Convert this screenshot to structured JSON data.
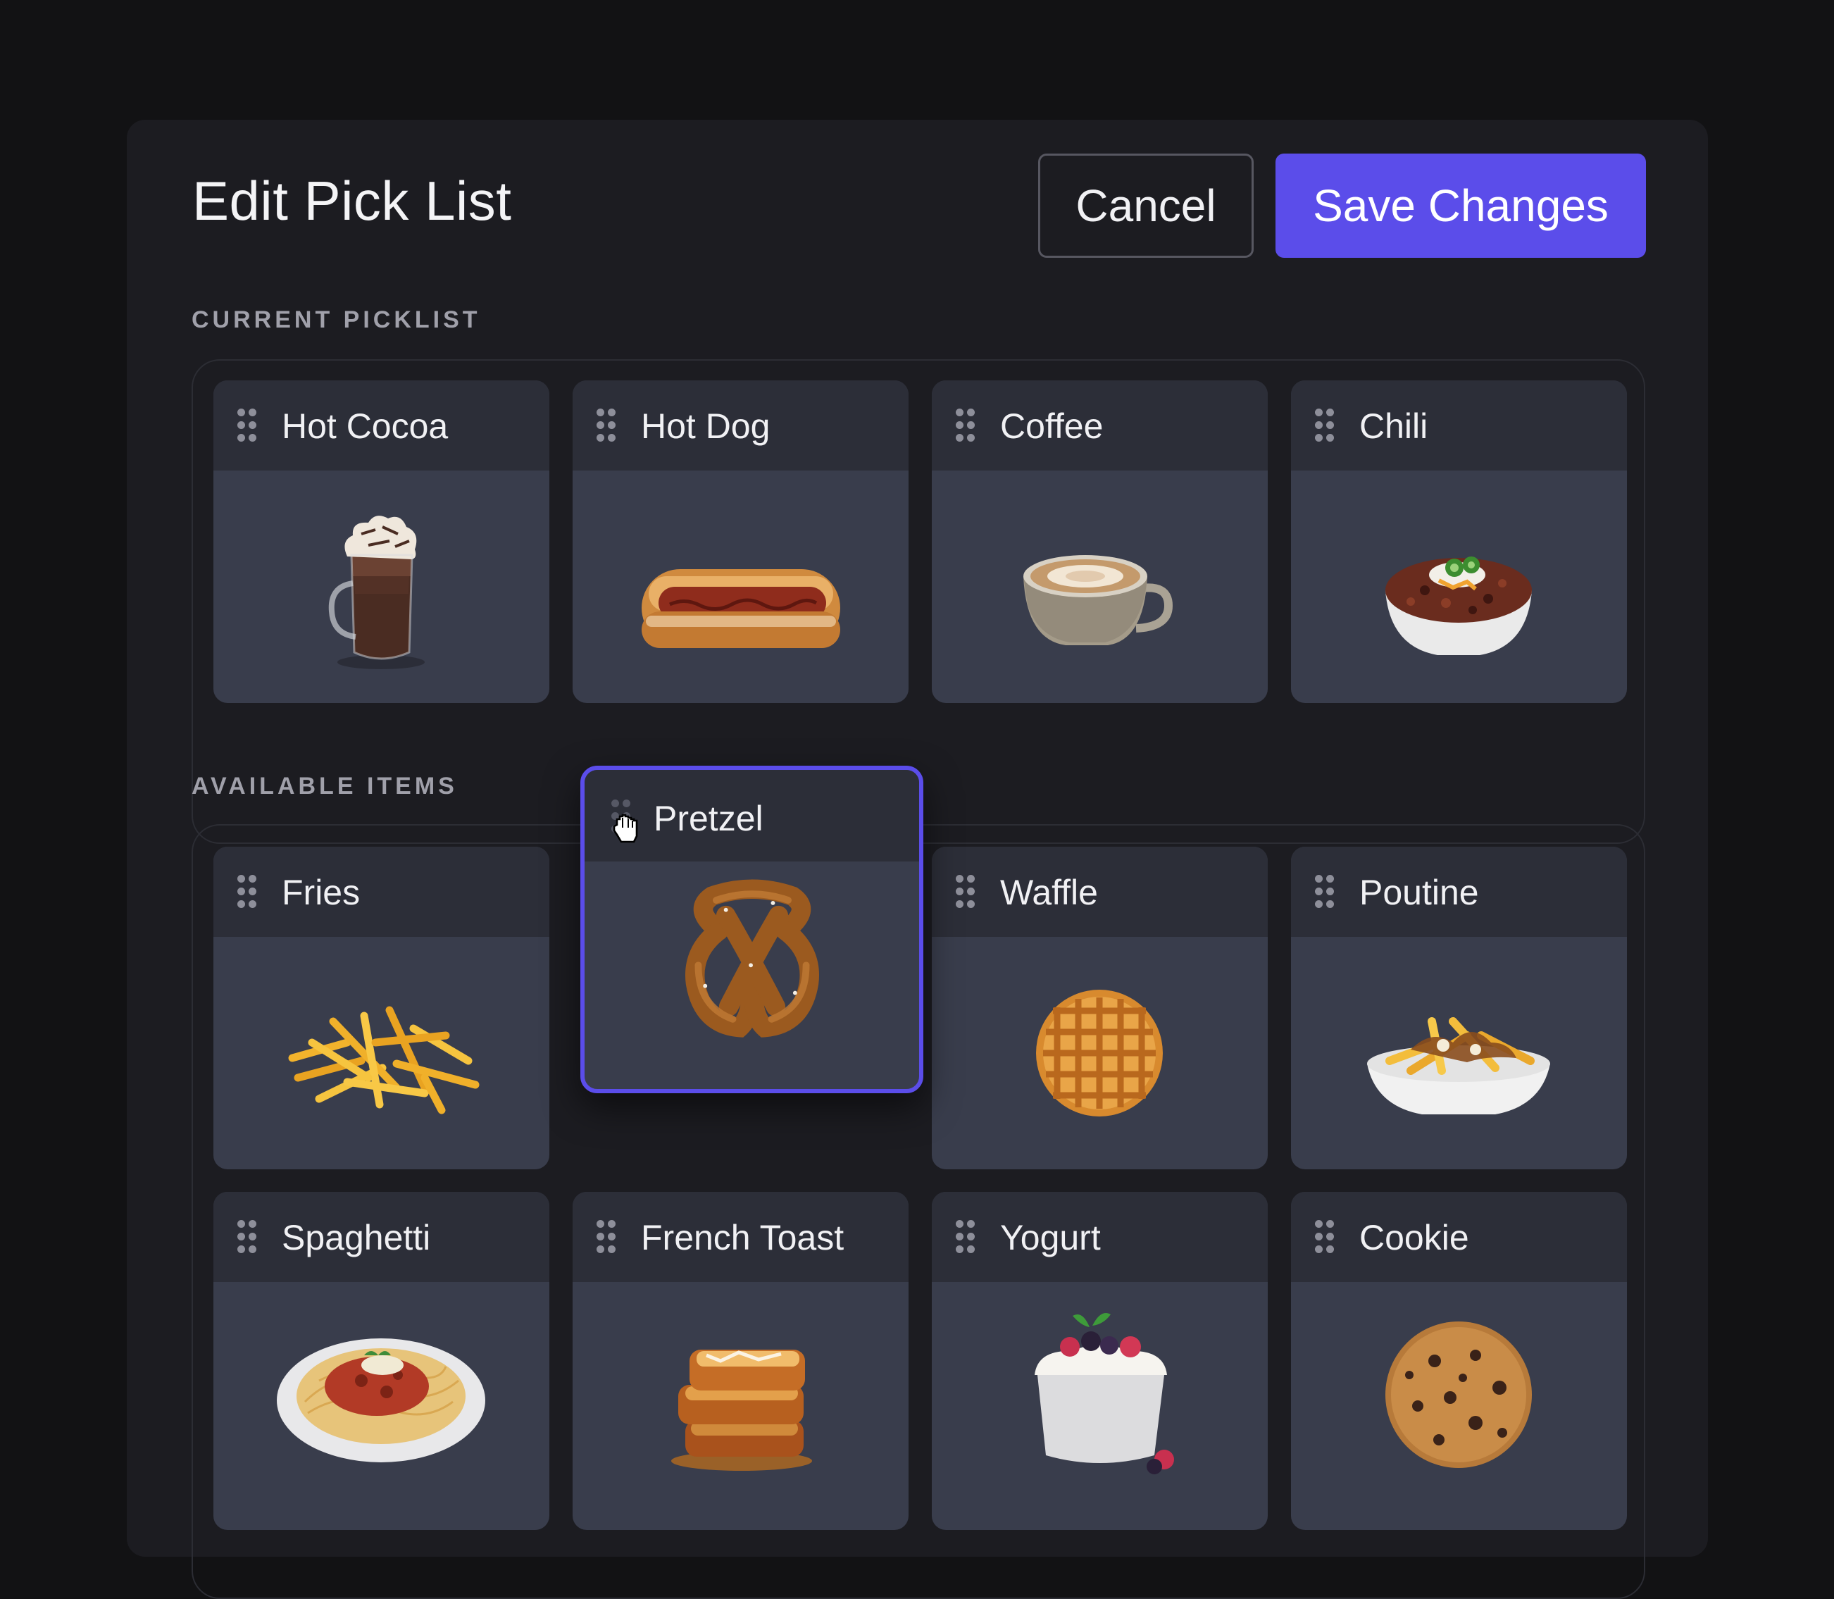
{
  "header": {
    "title": "Edit Pick List",
    "cancel_label": "Cancel",
    "save_label": "Save Changes"
  },
  "sections": {
    "current": "CURRENT PICKLIST",
    "available": "AVAILABLE ITEMS"
  },
  "current_items": [
    {
      "label": "Hot Cocoa",
      "icon": "hot-cocoa-image"
    },
    {
      "label": "Hot Dog",
      "icon": "hot-dog-image"
    },
    {
      "label": "Coffee",
      "icon": "coffee-image"
    },
    {
      "label": "Chili",
      "icon": "chili-image"
    }
  ],
  "available_items": [
    {
      "label": "Fries",
      "icon": "fries-image"
    },
    {
      "label": "Waffle",
      "icon": "waffle-image"
    },
    {
      "label": "Poutine",
      "icon": "poutine-image"
    },
    {
      "label": "Spaghetti",
      "icon": "spaghetti-image"
    },
    {
      "label": "French Toast",
      "icon": "french-toast-image"
    },
    {
      "label": "Yogurt",
      "icon": "yogurt-image"
    },
    {
      "label": "Cookie",
      "icon": "cookie-image"
    }
  ],
  "dragging_item": {
    "label": "Pretzel",
    "icon": "pretzel-image"
  },
  "colors": {
    "accent": "#5b4dea",
    "background": "#121214",
    "panel": "#1c1c21",
    "card": "#393d4c",
    "card_header": "#2c2e38"
  }
}
